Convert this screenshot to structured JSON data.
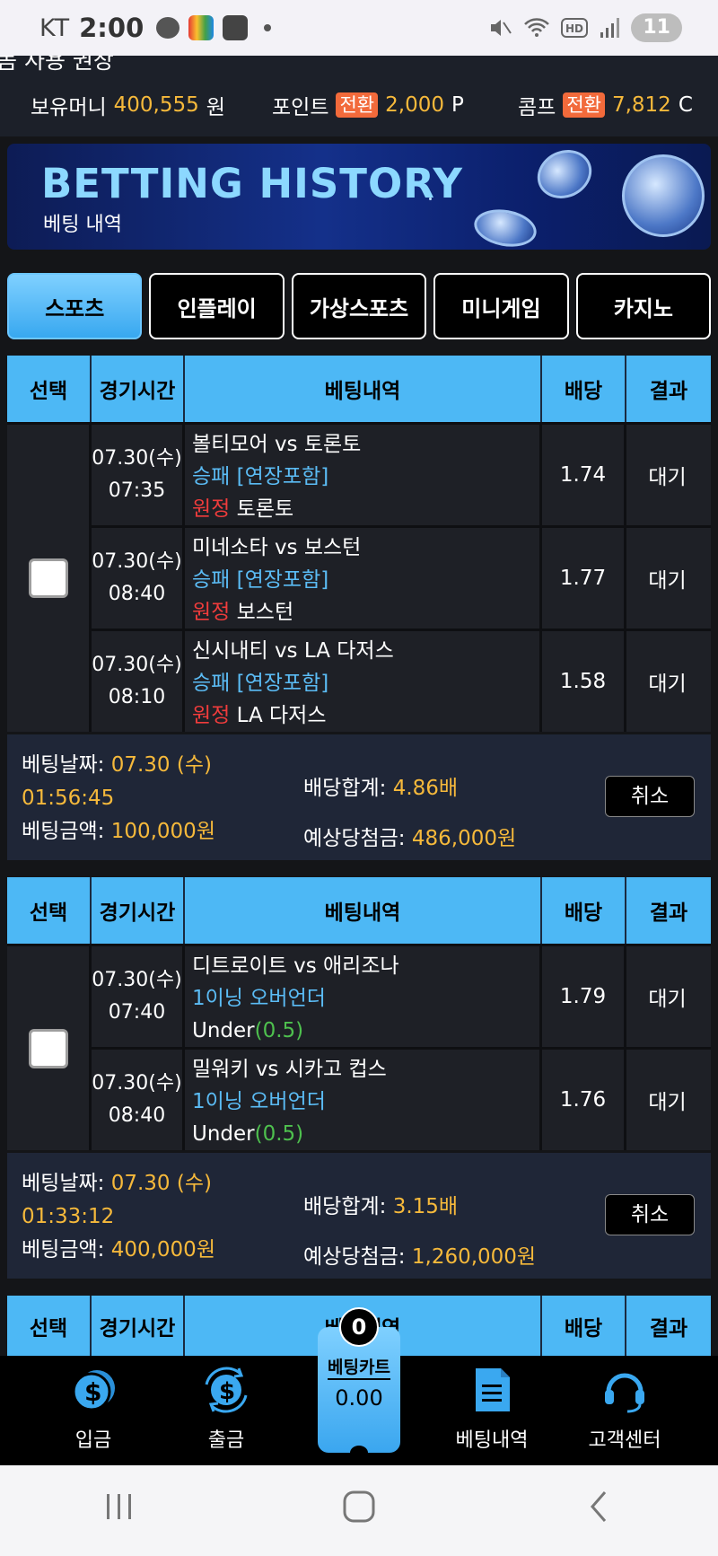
{
  "status_bar": {
    "carrier": "KT",
    "time": "2:00",
    "battery": "11"
  },
  "notice_partial": "돔 사용 권장",
  "money_bar": {
    "money_label": "보유머니",
    "money_value": "400,555",
    "money_unit": "원",
    "point_label": "포인트",
    "point_swap": "전환",
    "point_value": "2,000",
    "point_unit": "P",
    "comp_label": "콤프",
    "comp_swap": "전환",
    "comp_value": "7,812",
    "comp_unit": "C"
  },
  "banner": {
    "title": "BETTING HISTORY",
    "subtitle": "베팅 내역"
  },
  "tabs": [
    {
      "label": "스포츠",
      "active": true
    },
    {
      "label": "인플레이",
      "active": false
    },
    {
      "label": "가상스포츠",
      "active": false
    },
    {
      "label": "미니게임",
      "active": false
    },
    {
      "label": "카지노",
      "active": false
    }
  ],
  "table_headers": {
    "select": "선택",
    "time": "경기시간",
    "detail": "베팅내역",
    "odds": "배당",
    "result": "결과"
  },
  "bets": [
    {
      "rows": [
        {
          "date": "07.30(수)",
          "time": "07:35",
          "match": "볼티모어 vs 토론토",
          "market": "승패 [연장포함]",
          "pick_side": "원정",
          "pick": "토론토",
          "odds": "1.74",
          "result": "대기"
        },
        {
          "date": "07.30(수)",
          "time": "08:40",
          "match": "미네소타 vs 보스턴",
          "market": "승패 [연장포함]",
          "pick_side": "원정",
          "pick": "보스턴",
          "odds": "1.77",
          "result": "대기"
        },
        {
          "date": "07.30(수)",
          "time": "08:10",
          "match": "신시내티 vs LA 다저스",
          "market": "승패 [연장포함]",
          "pick_side": "원정",
          "pick": "LA 다저스",
          "odds": "1.58",
          "result": "대기"
        }
      ],
      "summary": {
        "date_label": "베팅날짜:",
        "date_value": "07.30 (수)",
        "time_value": "01:56:45",
        "amount_label": "베팅금액:",
        "amount_value": "100,000원",
        "total_odds_label": "배당합계:",
        "total_odds_value": "4.86배",
        "expected_label": "예상당첨금:",
        "expected_value": "486,000원",
        "cancel": "취소"
      }
    },
    {
      "rows": [
        {
          "date": "07.30(수)",
          "time": "07:40",
          "match": "디트로이트 vs 애리조나",
          "market": "1이닝 오버언더",
          "pick_text": "Under",
          "pick_line": "(0.5)",
          "odds": "1.79",
          "result": "대기"
        },
        {
          "date": "07.30(수)",
          "time": "08:40",
          "match": "밀워키 vs 시카고 컵스",
          "market": "1이닝 오버언더",
          "pick_text": "Under",
          "pick_line": "(0.5)",
          "odds": "1.76",
          "result": "대기"
        }
      ],
      "summary": {
        "date_label": "베팅날짜:",
        "date_value": "07.30 (수)",
        "time_value": "01:33:12",
        "amount_label": "베팅금액:",
        "amount_value": "400,000원",
        "total_odds_label": "배당합계:",
        "total_odds_value": "3.15배",
        "expected_label": "예상당첨금:",
        "expected_value": "1,260,000원",
        "cancel": "취소"
      }
    }
  ],
  "bottom_nav": {
    "deposit": "입금",
    "withdraw": "출금",
    "cart_label": "베팅카트",
    "cart_count": "0",
    "cart_total": "0.00",
    "history": "베팅내역",
    "support": "고객센터"
  },
  "colors": {
    "accent_blue": "#4db8f5",
    "gold": "#f6b93b",
    "swap_orange": "#f26a3b",
    "away_red": "#f03c3c",
    "line_green": "#4ec04e"
  }
}
